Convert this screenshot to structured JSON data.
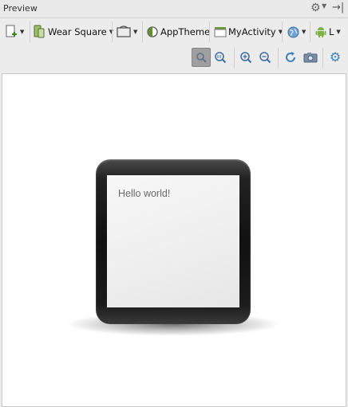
{
  "panel": {
    "title": "Preview"
  },
  "toolbar": {
    "device": "Wear Square",
    "theme": "AppTheme",
    "activity": "MyActivity",
    "api_level": "L"
  },
  "screen": {
    "text": "Hello world!"
  },
  "colors": {
    "android_green": "#7cb342",
    "accent_blue": "#3f7fbf"
  },
  "icons": {
    "new_config": "new-configuration-icon",
    "device": "device-icon",
    "orientation": "orientation-icon",
    "theme": "theme-icon",
    "activity": "activity-icon",
    "locale": "globe-icon",
    "android": "android-icon",
    "zoom_fit": "zoom-to-fit-icon",
    "zoom_actual": "zoom-actual-size-icon",
    "zoom_in": "zoom-in-icon",
    "zoom_out": "zoom-out-icon",
    "refresh": "refresh-icon",
    "screenshot": "camera-icon",
    "options": "gear-icon"
  }
}
